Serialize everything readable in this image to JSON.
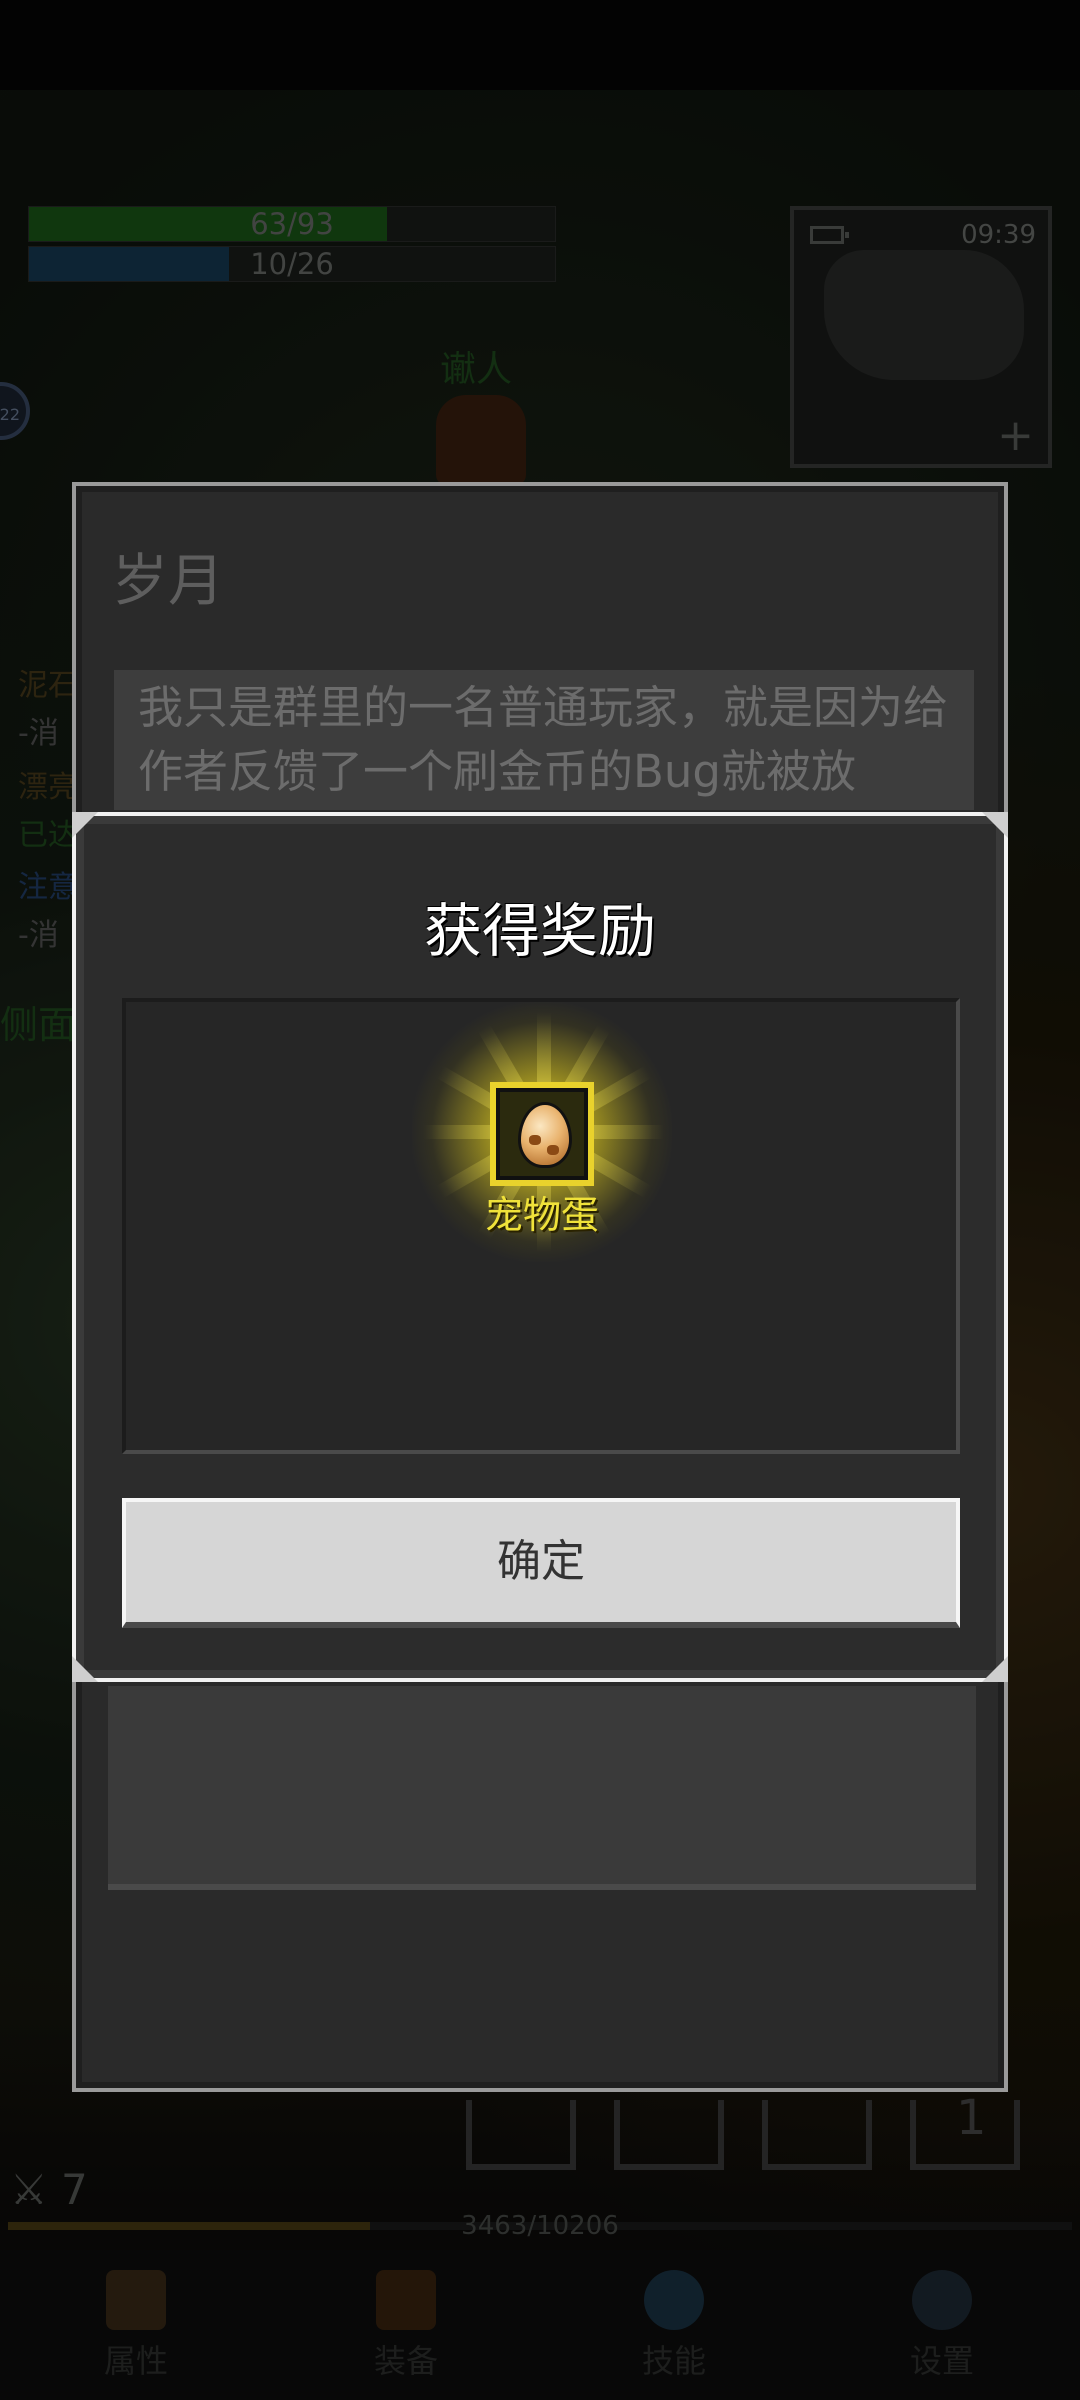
{
  "hud": {
    "hp_text": "63/93",
    "hp_fraction": 0.68,
    "mp_text": "10/26",
    "mp_fraction": 0.38,
    "minimap_time": "09:39",
    "npc_name": "谳人",
    "badge_text": "22",
    "slot_number": "1",
    "attack_value": "7",
    "exp_text": "3463/10206",
    "exp_fraction": 0.34
  },
  "side_log": [
    "泥石",
    "-消",
    "漂亮",
    "已达",
    "注意",
    "-消",
    "侧面"
  ],
  "bottom_nav": [
    {
      "label": "属性",
      "icon": "helmet-icon"
    },
    {
      "label": "装备",
      "icon": "bag-icon"
    },
    {
      "label": "技能",
      "icon": "skill-gem-icon"
    },
    {
      "label": "设置",
      "icon": "gear-icon"
    }
  ],
  "background_panel": {
    "title": "岁月",
    "text": "我只是群里的一名普通玩家，就是因为给作者反馈了一个刷金币的Bug就被放"
  },
  "reward_dialog": {
    "title": "获得奖励",
    "item_name": "宠物蛋",
    "item_icon": "pet-egg-icon",
    "confirm_label": "确定"
  },
  "colors": {
    "hp": "#1a5a18",
    "mp": "#163a55",
    "item_frame": "#e9d22c",
    "item_name": "#f0e23a"
  }
}
